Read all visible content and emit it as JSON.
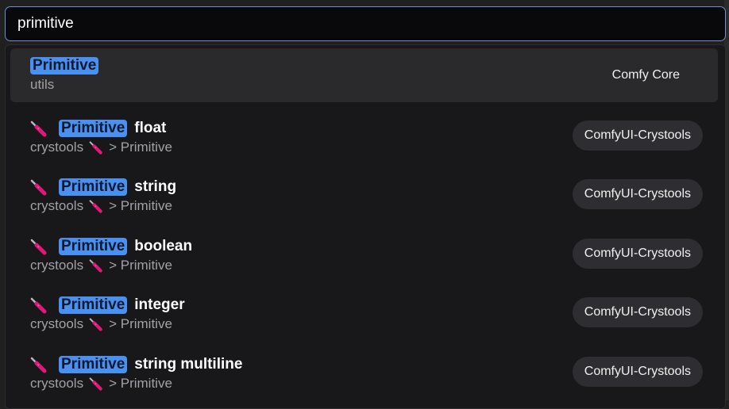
{
  "search": {
    "value": "primitive"
  },
  "results": [
    {
      "highlight": "Primitive",
      "rest": "",
      "has_emoji": false,
      "category": "utils",
      "category_emoji": false,
      "category_tail": "",
      "badge": "Comfy Core",
      "active": true
    },
    {
      "highlight": "Primitive",
      "rest": "float",
      "has_emoji": true,
      "category": "crystools",
      "category_emoji": true,
      "category_tail": "> Primitive",
      "badge": "ComfyUI-Crystools",
      "active": false
    },
    {
      "highlight": "Primitive",
      "rest": "string",
      "has_emoji": true,
      "category": "crystools",
      "category_emoji": true,
      "category_tail": "> Primitive",
      "badge": "ComfyUI-Crystools",
      "active": false
    },
    {
      "highlight": "Primitive",
      "rest": "boolean",
      "has_emoji": true,
      "category": "crystools",
      "category_emoji": true,
      "category_tail": "> Primitive",
      "badge": "ComfyUI-Crystools",
      "active": false
    },
    {
      "highlight": "Primitive",
      "rest": "integer",
      "has_emoji": true,
      "category": "crystools",
      "category_emoji": true,
      "category_tail": "> Primitive",
      "badge": "ComfyUI-Crystools",
      "active": false
    },
    {
      "highlight": "Primitive",
      "rest": "string multiline",
      "has_emoji": true,
      "category": "crystools",
      "category_emoji": true,
      "category_tail": "> Primitive",
      "badge": "ComfyUI-Crystools",
      "active": false
    }
  ],
  "icons": {
    "title_emoji": "screwdriver-icon",
    "category_emoji": "screwdriver-icon"
  },
  "colors": {
    "highlight": "#4a90f0",
    "accent_border": "#6d8fd6",
    "badge_bg": "#2e2e32"
  }
}
